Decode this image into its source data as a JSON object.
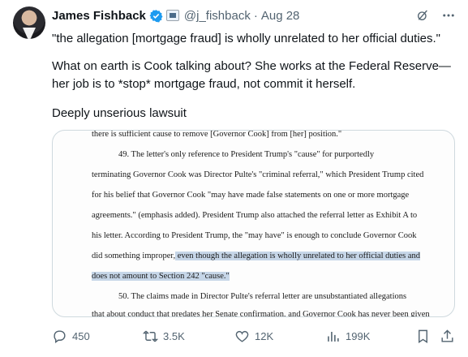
{
  "author": {
    "name": "James Fishback",
    "handle": "@j_fishback",
    "date": "Aug 28"
  },
  "tweet": {
    "line1": "\"the allegation [mortgage fraud] is wholly unrelated to her official duties.\"",
    "line2a": "What on earth is Cook talking about? She works at the Federal Reserve—",
    "line2b": "her job is to *stop* mortgage fraud, not commit it herself.",
    "line3": "Deeply unserious lawsuit"
  },
  "document": {
    "lines": [
      "there is sufficient cause to remove [Governor Cook] from [her] position.\"",
      "49.      The letter's only reference to President Trump's \"cause\" for purportedly",
      "terminating Governor Cook was Director Pulte's \"criminal referral,\" which President Trump cited",
      "for his belief that Governor Cook \"may have made false statements on one or more mortgage",
      "agreements.\" (emphasis added). President Trump also attached the referral letter as Exhibit A to",
      "his letter.  According to President Trump, the \"may have\" is enough to conclude Governor Cook",
      "did something improper,",
      " even though the allegation is wholly unrelated to her official duties and",
      "does not amount to Section 242 \"cause.\"",
      "50.      The claims made in Director Pulte's referral letter are unsubstantiated allegations",
      "that about conduct that predates her Senate confirmation, and Governor Cook has never been given"
    ]
  },
  "actions": {
    "replies": "450",
    "reposts": "3.5K",
    "likes": "12K",
    "views": "199K"
  },
  "icons": [
    "verified-badge-icon",
    "affiliate-badge-icon",
    "grok-icon",
    "more-icon",
    "reply-icon",
    "repost-icon",
    "like-icon",
    "views-icon",
    "bookmark-icon",
    "share-icon"
  ],
  "colors": {
    "text": "#0f1419",
    "muted": "#536471",
    "verified": "#1d9bf0",
    "highlight": "#c6d6e8"
  }
}
